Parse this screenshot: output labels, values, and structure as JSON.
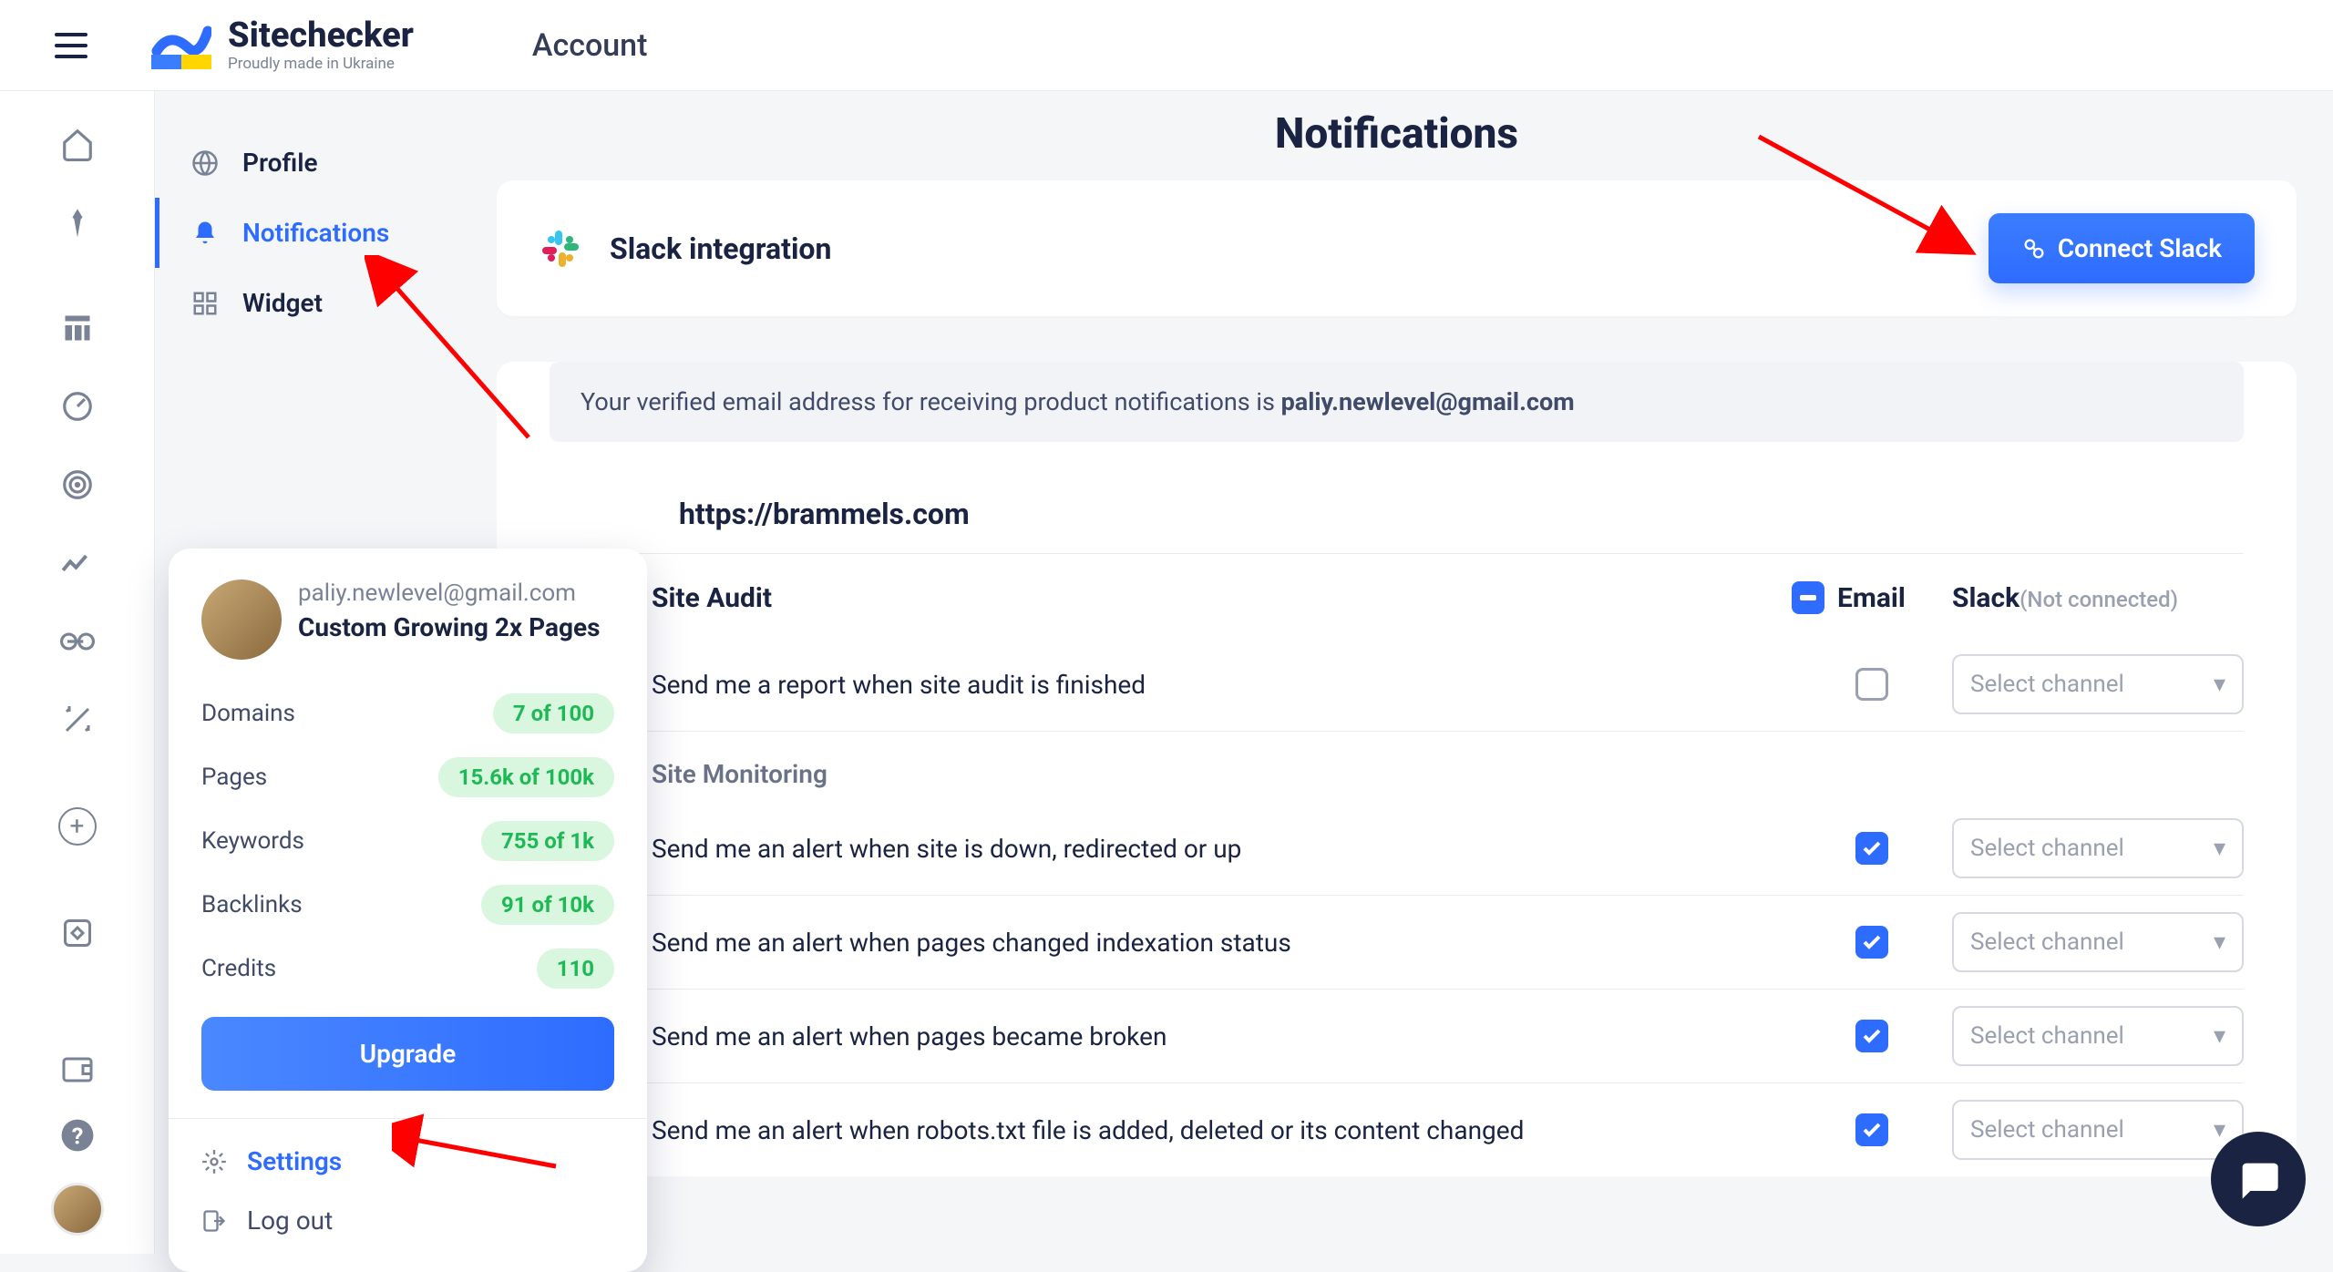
{
  "header": {
    "brand": "Sitechecker",
    "tagline": "Proudly made in Ukraine",
    "section": "Account"
  },
  "side_menu": {
    "items": [
      {
        "label": "Profile"
      },
      {
        "label": "Notifications"
      },
      {
        "label": "Widget"
      }
    ]
  },
  "page": {
    "title": "Notifications",
    "slack": {
      "title": "Slack integration",
      "button": "Connect Slack"
    },
    "verify_prefix": "Your verified email address for receiving product notifications is ",
    "verify_email": "paliy.newlevel@gmail.com",
    "site_url": "https://brammels.com",
    "cols": {
      "email": "Email",
      "slack": "Slack",
      "slack_status": "(Not connected)"
    },
    "select_placeholder": "Select channel",
    "sections": [
      {
        "name": "Site Audit",
        "rows": [
          {
            "label": "Send me a report when site audit is finished",
            "email": false
          }
        ]
      },
      {
        "name": "Site Monitoring",
        "rows": [
          {
            "label": "Send me an alert when site is down, redirected or up",
            "email": true
          },
          {
            "label": "Send me an alert when pages changed indexation status",
            "email": true
          },
          {
            "label": "Send me an alert when pages became broken",
            "email": true
          },
          {
            "label": "Send me an alert when robots.txt file is added, deleted or its content changed",
            "email": true
          }
        ]
      }
    ]
  },
  "popover": {
    "email": "paliy.newlevel@gmail.com",
    "plan": "Custom Growing 2x Pages",
    "stats": [
      {
        "label": "Domains",
        "value": "7 of 100"
      },
      {
        "label": "Pages",
        "value": "15.6k of 100k"
      },
      {
        "label": "Keywords",
        "value": "755 of 1k"
      },
      {
        "label": "Backlinks",
        "value": "91 of 10k"
      },
      {
        "label": "Credits",
        "value": "110"
      }
    ],
    "upgrade": "Upgrade",
    "settings": "Settings",
    "logout": "Log out"
  }
}
